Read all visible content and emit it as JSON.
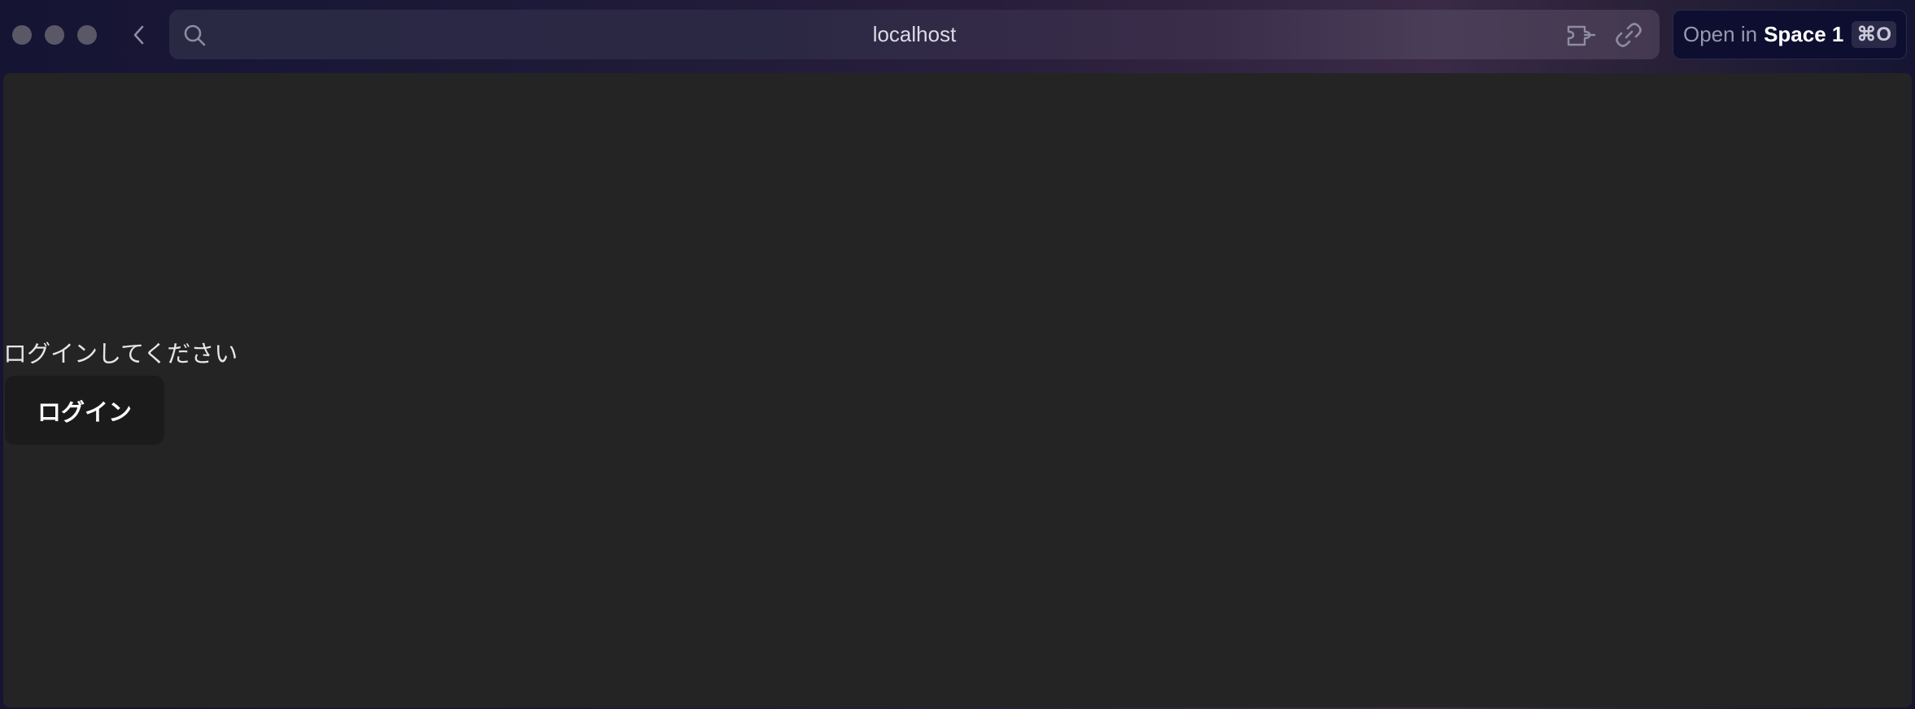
{
  "browser": {
    "url": "localhost",
    "open_button": {
      "prefix": "Open in",
      "space": "Space 1",
      "shortcut": "⌘O"
    },
    "icons": {
      "back": "chevron-left-icon",
      "search": "search-icon",
      "extension": "extension-icon",
      "link": "link-icon"
    }
  },
  "page": {
    "prompt": "ログインしてください",
    "login_button": "ログイン"
  },
  "colors": {
    "page_background": "#242424",
    "button_background": "#1b1b1b",
    "text": "#e6e6e6"
  }
}
